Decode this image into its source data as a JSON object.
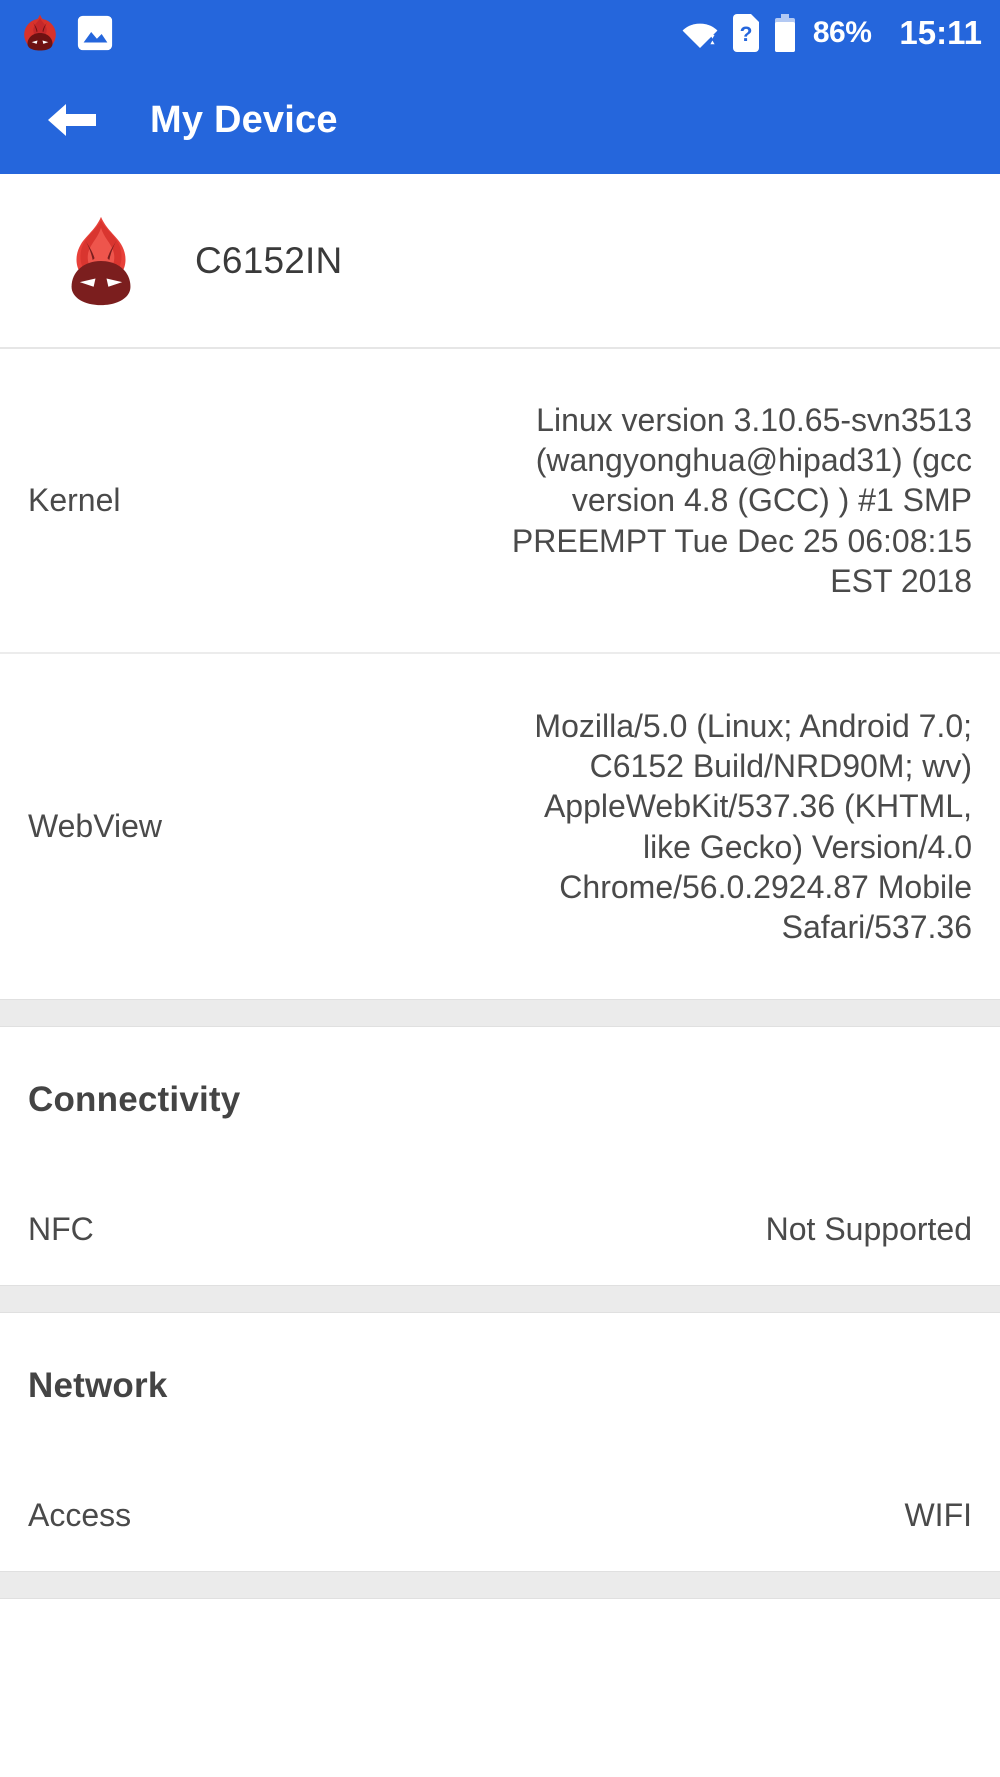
{
  "statusbar": {
    "notification_icons": [
      "antutu-icon",
      "gallery-icon"
    ],
    "wifi_icon": "wifi-icon",
    "sim_icon": "sim-card-question-icon",
    "battery_icon": "battery-icon",
    "battery_text": "86%",
    "clock": "15:11",
    "background_color": "#2566DC",
    "foreground_color": "#FFFFFF"
  },
  "appbar": {
    "back_icon": "back-arrow-icon",
    "title": "My Device"
  },
  "device": {
    "logo_icon": "antutu-logo-icon",
    "name": "C6152IN"
  },
  "info_rows": [
    {
      "label": "Kernel",
      "value": "Linux version 3.10.65-svn3513 (wangyonghua@hipad31) (gcc version 4.8 (GCC) ) #1 SMP PREEMPT Tue Dec 25 06:08:15 EST 2018"
    },
    {
      "label": "WebView",
      "value": "Mozilla/5.0 (Linux; Android 7.0; C6152 Build/NRD90M; wv) AppleWebKit/537.36 (KHTML, like Gecko) Version/4.0 Chrome/56.0.2924.87 Mobile Safari/537.36"
    }
  ],
  "sections": [
    {
      "title": "Connectivity",
      "rows": [
        {
          "label": "NFC",
          "value": "Not Supported"
        }
      ]
    },
    {
      "title": "Network",
      "rows": [
        {
          "label": "Access",
          "value": "WIFI"
        }
      ]
    }
  ],
  "colors": {
    "accent": "#2566DC",
    "band": "#EBEBEB",
    "text": "#4A4A4A",
    "logo_flame": "#E8413A",
    "logo_face": "#7B1E1E"
  }
}
